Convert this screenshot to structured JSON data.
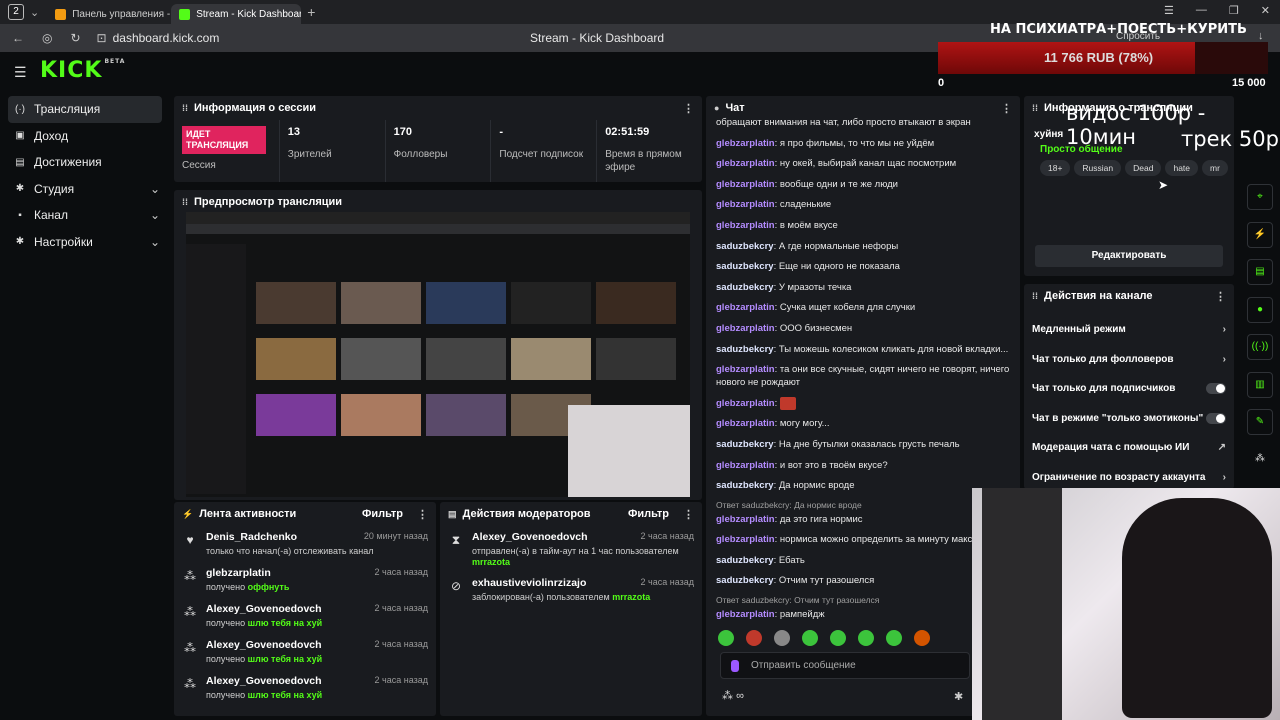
{
  "browser": {
    "tab_count": "2",
    "tabs": [
      {
        "label": "Панель управления - Do"
      },
      {
        "label": "Stream - Kick Dashboar"
      }
    ],
    "url": "dashboard.kick.com",
    "page_title": "Stream - Kick Dashboard",
    "ask_label": "Спросить"
  },
  "brand": {
    "logo": "KICK",
    "beta": "BETA",
    "accent": "#53fc18"
  },
  "sidebar": {
    "items": [
      {
        "label": "Трансляция",
        "icon": "broadcast-icon"
      },
      {
        "label": "Доход",
        "icon": "wallet-icon"
      },
      {
        "label": "Достижения",
        "icon": "trophy-icon"
      },
      {
        "label": "Студия",
        "icon": "gear-icon"
      },
      {
        "label": "Канал",
        "icon": "user-icon"
      },
      {
        "label": "Настройки",
        "icon": "settings-icon"
      }
    ]
  },
  "session": {
    "title": "Информация о сессии",
    "badge": "ИДЕТ ТРАНСЛЯЦИЯ",
    "badge_label": "Сессия",
    "stats": [
      {
        "value": "13",
        "label": "Зрителей"
      },
      {
        "value": "170",
        "label": "Фолловеры"
      },
      {
        "value": "-",
        "label": "Подсчет подписок"
      },
      {
        "value": "02:51:59",
        "label": "Время в прямом эфире"
      }
    ]
  },
  "preview": {
    "title": "Предпросмотр трансляции"
  },
  "activity": {
    "title": "Лента активности",
    "filter": "Фильтр",
    "items": [
      {
        "name": "Denis_Radchenko",
        "time": "20 минут назад",
        "desc": "только что начал(-а) отслеживать канал",
        "highlight": "",
        "icon": "heart-icon"
      },
      {
        "name": "glebzarplatin",
        "time": "2 часа назад",
        "desc": "получено",
        "highlight": "оффнуть",
        "icon": "points-icon"
      },
      {
        "name": "Alexey_Govenoedovch",
        "time": "2 часа назад",
        "desc": "получено",
        "highlight": "шлю тебя на хуй",
        "icon": "points-icon"
      },
      {
        "name": "Alexey_Govenoedovch",
        "time": "2 часа назад",
        "desc": "получено",
        "highlight": "шлю тебя на хуй",
        "icon": "points-icon"
      },
      {
        "name": "Alexey_Govenoedovch",
        "time": "2 часа назад",
        "desc": "получено",
        "highlight": "шлю тебя на хуй",
        "icon": "points-icon"
      }
    ]
  },
  "mod_actions": {
    "title": "Действия модераторов",
    "filter": "Фильтр",
    "items": [
      {
        "name": "Alexey_Govenoedovch",
        "time": "2 часа назад",
        "desc": "отправлен(-а) в тайм-аут на 1 час пользователем",
        "mod": "mrrazota",
        "icon": "hourglass-icon"
      },
      {
        "name": "exhaustiveviolinrzizajo",
        "time": "2 часа назад",
        "desc": "заблокирован(-а) пользователем",
        "mod": "mrrazota",
        "icon": "ban-icon"
      }
    ]
  },
  "chat": {
    "title": "Чат",
    "messages": [
      {
        "user": "",
        "text": "обращают внимания на чат, либо просто втыкают в экран",
        "color": "p"
      },
      {
        "user": "glebzarplatin",
        "text": "я про фильмы, то что мы не уйдём",
        "color": "p"
      },
      {
        "user": "glebzarplatin",
        "text": "ну окей, выбирай канал щас посмотрим",
        "color": "p"
      },
      {
        "user": "glebzarplatin",
        "text": "вообще одни и те же люди",
        "color": "p"
      },
      {
        "user": "glebzarplatin",
        "text": "сладенькие",
        "color": "p"
      },
      {
        "user": "glebzarplatin",
        "text": "в моём вкусе",
        "color": "p"
      },
      {
        "user": "saduzbekcry",
        "text": "А где нормальные нефоры",
        "color": "b"
      },
      {
        "user": "saduzbekcry",
        "text": "Еще ни одного не показала",
        "color": "b"
      },
      {
        "user": "saduzbekcry",
        "text": "У мразоты течка",
        "color": "b"
      },
      {
        "user": "glebzarplatin",
        "text": "Сучка ищет кобеля для случки",
        "color": "p"
      },
      {
        "user": "glebzarplatin",
        "text": "ООО бизнесмен",
        "color": "p"
      },
      {
        "user": "saduzbekcry",
        "text": "Ты можешь колесиком кликать для новой вкладки...",
        "color": "b"
      },
      {
        "user": "glebzarplatin",
        "text": "та они все скучные, сидят ничего не говорят, ничего нового не рождают",
        "color": "p"
      },
      {
        "user": "glebzarplatin",
        "text": "",
        "color": "p",
        "emote": true
      },
      {
        "user": "glebzarplatin",
        "text": "могу могу...",
        "color": "p"
      },
      {
        "user": "saduzbekcry",
        "text": "На дне бутылки оказалась грусть печаль",
        "color": "b"
      },
      {
        "user": "glebzarplatin",
        "text": "и вот это в твоём вкусе?",
        "color": "p"
      },
      {
        "user": "saduzbekcry",
        "text": "Да нормис вроде",
        "color": "b"
      }
    ],
    "reply1": "Ответ saduzbekcry: Да нормис вроде",
    "messages2": [
      {
        "user": "glebzarplatin",
        "text": "да это гига нормис",
        "color": "p"
      },
      {
        "user": "glebzarplatin",
        "text": "нормиса можно определить за минуту максі",
        "color": "p"
      },
      {
        "user": "saduzbekcry",
        "text": "Ебать",
        "color": "b"
      },
      {
        "user": "saduzbekcry",
        "text": "Отчим тут разошелся",
        "color": "b"
      }
    ],
    "reply2": "Ответ saduzbekcry: Отчим тут разошелся",
    "messages3": [
      {
        "user": "glebzarplatin",
        "text": "рампейдж",
        "color": "p"
      }
    ],
    "input_placeholder": "Отправить сообщение",
    "footer": "∞"
  },
  "stream_info": {
    "title": "Информация о трансляции",
    "stream_title": "хуйня",
    "category": "Просто общение",
    "tags": [
      "18+",
      "Russian",
      "Dead",
      "hate",
      "mr"
    ],
    "edit_button": "Редактировать"
  },
  "channel_actions": {
    "title": "Действия на канале",
    "items": [
      {
        "label": "Медленный режим",
        "control": "chevron"
      },
      {
        "label": "Чат только для фолловеров",
        "control": "chevron"
      },
      {
        "label": "Чат только для подписчиков",
        "control": "toggle"
      },
      {
        "label": "Чат в режиме \"только эмотиконы\"",
        "control": "toggle"
      },
      {
        "label": "Модерация чата с помощью ИИ",
        "control": "external"
      },
      {
        "label": "Ограничение по возрасту аккаунта",
        "control": "chevron"
      }
    ]
  },
  "overlay": {
    "title": "НА ПСИХИАТРА+ПОЕСТЬ+КУРИТЬ",
    "amount": "11 766 RUB (78%)",
    "progress": 0.78,
    "min": "0",
    "max": "15 000",
    "line1": "видос 100р - 10мин",
    "line2": "трек 50р"
  },
  "rail": [
    "scan-icon",
    "lightning-icon",
    "clipboard-icon",
    "chat-icon",
    "radio-icon",
    "layout-icon",
    "wrench-icon"
  ]
}
